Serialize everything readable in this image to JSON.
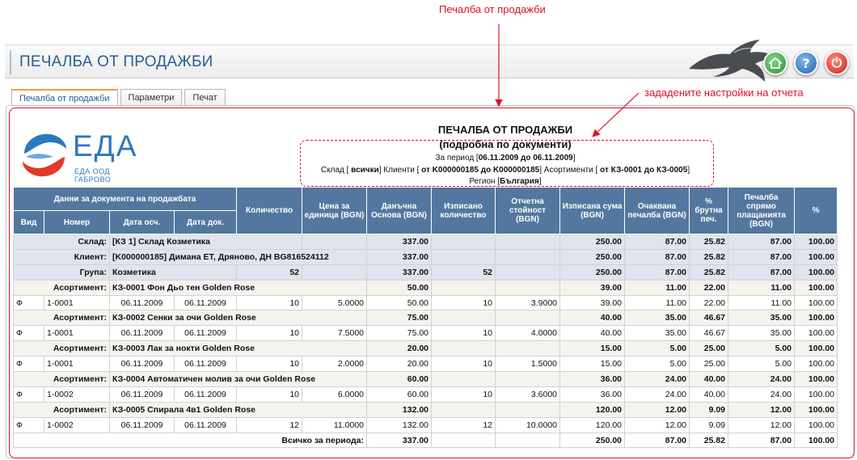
{
  "annotations": {
    "top": "Печалба от продажби",
    "right": "зададените настройки на отчета"
  },
  "header": {
    "title": "ПЕЧАЛБА ОТ ПРОДАЖБИ",
    "buttons": {
      "home_icon": "home-icon",
      "help_icon": "?",
      "power_icon": "⏻"
    }
  },
  "tabs": [
    "Печалба от продажби",
    "Параметри",
    "Печат"
  ],
  "logo": {
    "name": "ЕДА",
    "sub": "ЕДА ООД ГАБРОВО"
  },
  "report": {
    "title": "ПЕЧАЛБА ОТ ПРОДАЖБИ",
    "subtitle": "(подробна по документи)",
    "period_label": "За период [",
    "period_value": "06.11.2009 до 06.11.2009",
    "period_end": "]",
    "warehouse_label": "Склад [",
    "warehouse_value": " всички",
    "clients_label": "] Клиенти [",
    "clients_value": " от K000000185 до K000000185",
    "assort_label": "] Асортименти [",
    "assort_value": " от КЗ-0001 до КЗ-0005",
    "assort_end": "]",
    "region_label": "Регион [",
    "region_value": "България",
    "region_end": "]"
  },
  "table": {
    "header_group": "Данни за документа на продажбата",
    "columns": {
      "type": "Вид",
      "number": "Номер",
      "date_acc": "Дата осч.",
      "date_doc": "Дата док.",
      "qty": "Количество",
      "unit_price": "Цена за единица (BGN)",
      "tax_base": "Данъчна Основа (BGN)",
      "qty_written": "Изписано количество",
      "reporting_value": "Отчетна стойност (BGN)",
      "written_sum": "Изписана сума (BGN)",
      "expected_profit": "Очаквана печалба (BGN)",
      "gross_pct": "% брутна печ.",
      "profit_payments": "Печалба спрямо плащанията (BGN)",
      "pct": "%"
    },
    "groups": [
      {
        "label": "Склад:",
        "text": "[КЗ 1] Склад Козметика",
        "qty": "",
        "tax": "337.00",
        "qw": "",
        "rv": "",
        "ws": "250.00",
        "ep": "87.00",
        "gp": "25.82",
        "pp": "87.00",
        "pct": "100.00"
      },
      {
        "label": "Клиент:",
        "text": "[K000000185] Димана ЕТ, Дряново, ДН BG816524112",
        "qty": "",
        "tax": "337.00",
        "qw": "",
        "rv": "",
        "ws": "250.00",
        "ep": "87.00",
        "gp": "25.82",
        "pp": "87.00",
        "pct": "100.00"
      },
      {
        "label": "Група:",
        "text": "Козметика",
        "qty": "52",
        "tax": "337.00",
        "qw": "52",
        "rv": "",
        "ws": "250.00",
        "ep": "87.00",
        "gp": "25.82",
        "pp": "87.00",
        "pct": "100.00"
      }
    ],
    "articles": [
      {
        "label": "Асортимент:",
        "text": "КЗ-0001 Фон Дьо тен Golden Rose",
        "tax": "50.00",
        "ws": "39.00",
        "ep": "11.00",
        "gp": "22.00",
        "pp": "11.00",
        "pct": "100.00",
        "doc": {
          "type": "Ф",
          "number": "1-0001",
          "date_acc": "06.11.2009",
          "date_doc": "06.11.2009",
          "qty": "10",
          "price": "5.0000",
          "tax": "50.00",
          "qw": "10",
          "rv": "3.9000",
          "ws": "39.00",
          "ep": "11.00",
          "gp": "22.00",
          "pp": "11.00",
          "pct": "100.00"
        }
      },
      {
        "label": "Асортимент:",
        "text": "КЗ-0002 Сенки за очи Golden Rose",
        "tax": "75.00",
        "ws": "40.00",
        "ep": "35.00",
        "gp": "46.67",
        "pp": "35.00",
        "pct": "100.00",
        "doc": {
          "type": "Ф",
          "number": "1-0001",
          "date_acc": "06.11.2009",
          "date_doc": "06.11.2009",
          "qty": "10",
          "price": "7.5000",
          "tax": "75.00",
          "qw": "10",
          "rv": "4.0000",
          "ws": "40.00",
          "ep": "35.00",
          "gp": "46.67",
          "pp": "35.00",
          "pct": "100.00"
        }
      },
      {
        "label": "Асортимент:",
        "text": "КЗ-0003 Лак за нокти Golden Rose",
        "tax": "20.00",
        "ws": "15.00",
        "ep": "5.00",
        "gp": "25.00",
        "pp": "5.00",
        "pct": "100.00",
        "doc": {
          "type": "Ф",
          "number": "1-0001",
          "date_acc": "06.11.2009",
          "date_doc": "06.11.2009",
          "qty": "10",
          "price": "2.0000",
          "tax": "20.00",
          "qw": "10",
          "rv": "1.5000",
          "ws": "15.00",
          "ep": "5.00",
          "gp": "25.00",
          "pp": "5.00",
          "pct": "100.00"
        }
      },
      {
        "label": "Асортимент:",
        "text": "КЗ-0004 Автоматичен молив за очи Golden Rose",
        "tax": "60.00",
        "ws": "36.00",
        "ep": "24.00",
        "gp": "40.00",
        "pp": "24.00",
        "pct": "100.00",
        "doc": {
          "type": "Ф",
          "number": "1-0002",
          "date_acc": "06.11.2009",
          "date_doc": "06.11.2009",
          "qty": "10",
          "price": "6.0000",
          "tax": "60.00",
          "qw": "10",
          "rv": "3.6000",
          "ws": "36.00",
          "ep": "24.00",
          "gp": "40.00",
          "pp": "24.00",
          "pct": "100.00"
        }
      },
      {
        "label": "Асортимент:",
        "text": "КЗ-0005 Спирала 4в1 Golden Rose",
        "tax": "132.00",
        "ws": "120.00",
        "ep": "12.00",
        "gp": "9.09",
        "pp": "12.00",
        "pct": "100.00",
        "doc": {
          "type": "Ф",
          "number": "1-0002",
          "date_acc": "06.11.2009",
          "date_doc": "06.11.2009",
          "qty": "12",
          "price": "11.0000",
          "tax": "132.00",
          "qw": "12",
          "rv": "10.0000",
          "ws": "120.00",
          "ep": "12.00",
          "gp": "9.09",
          "pp": "12.00",
          "pct": "100.00"
        }
      }
    ],
    "total": {
      "label": "Всичко за периода:",
      "tax": "337.00",
      "ws": "250.00",
      "ep": "87.00",
      "gp": "25.82",
      "pp": "87.00",
      "pct": "100.00"
    }
  }
}
